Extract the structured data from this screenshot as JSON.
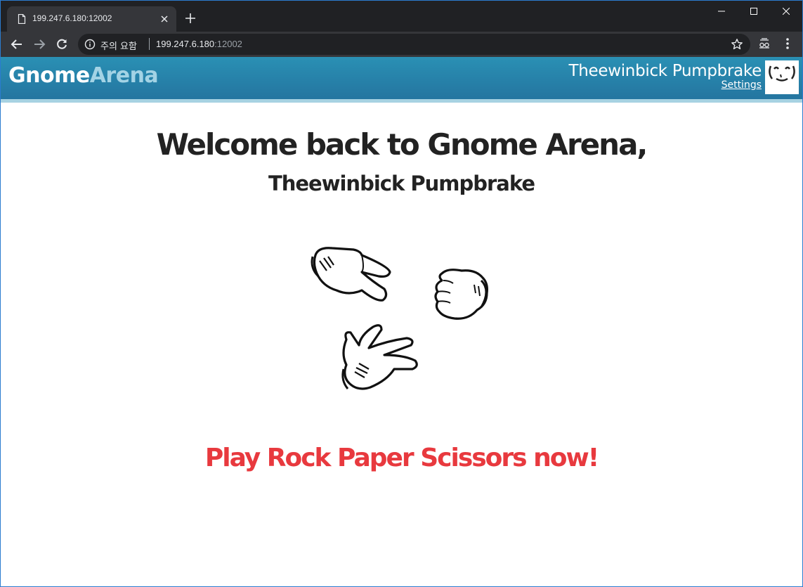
{
  "browser": {
    "tab_title": "199.247.6.180:12002",
    "security_label": "주의 요함",
    "url_host": "199.247.6.180",
    "url_port": ":12002"
  },
  "header": {
    "logo_part1": "Gnome",
    "logo_part2": "Arena",
    "username": "Theewinbick Pumpbrake",
    "settings_label": "Settings"
  },
  "main": {
    "welcome_title": "Welcome back to Gnome Arena,",
    "welcome_name": "Theewinbick Pumpbrake",
    "play_link": "Play Rock Paper Scissors now!"
  },
  "colors": {
    "header_blue": "#2a8ab0",
    "logo_light": "#a3d3e5",
    "play_red": "#e8393e"
  },
  "icons": [
    "page-icon",
    "close-icon",
    "plus-icon",
    "minimize-icon",
    "maximize-icon",
    "window-close-icon",
    "back-arrow-icon",
    "forward-arrow-icon",
    "reload-icon",
    "info-icon",
    "star-icon",
    "extension-icon",
    "menu-dots-icon",
    "avatar-face-icon",
    "scissors-hand-icon",
    "rock-hand-icon",
    "paper-hand-icon"
  ]
}
